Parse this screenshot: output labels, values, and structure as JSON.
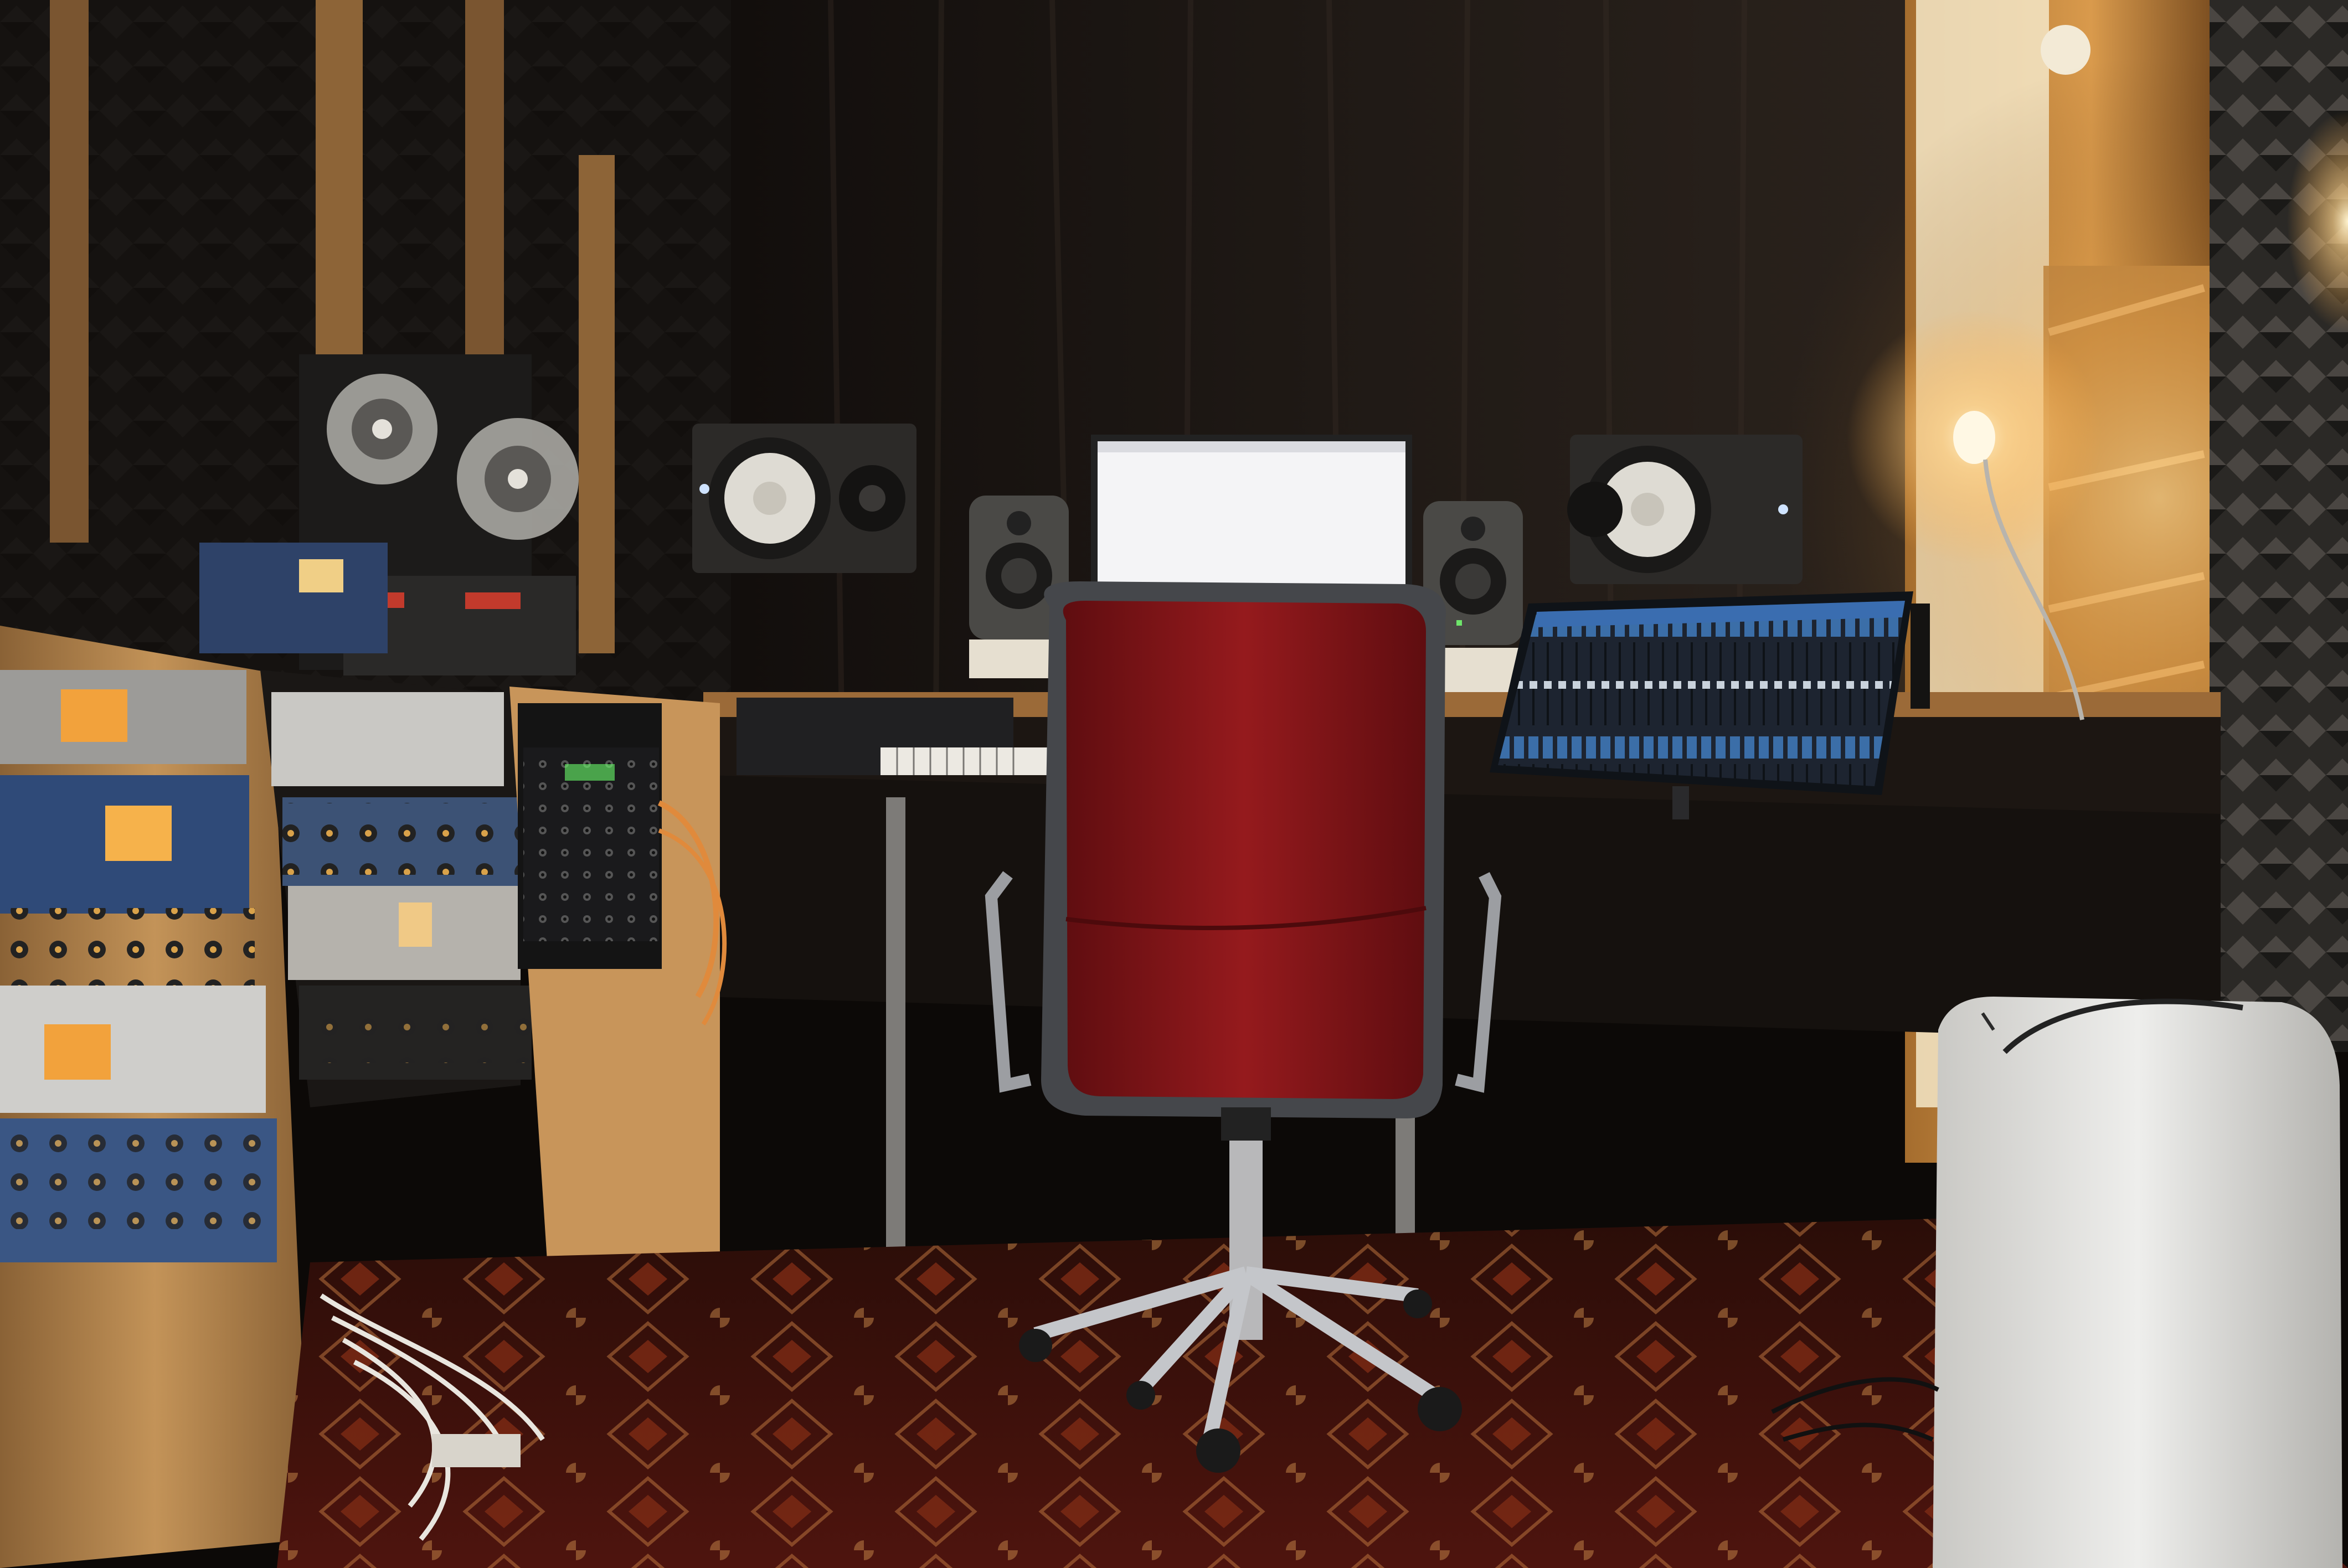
{
  "scene": {
    "type": "photograph",
    "subject": "home-recording-studio",
    "lighting": "warm-dim",
    "colors": {
      "wall_dark": "#14100d",
      "curtain": "#1c1714",
      "wood": "#b8864f",
      "rack_metal": "#9a9aa0",
      "rack_blue": "#2f4a78",
      "vu_glow": "#f2a23c",
      "lamp_glow": "#ffd38a",
      "chair_red": "#8a1418",
      "chair_frame": "#45474b",
      "monitor_white": "#f4f4f6",
      "daw_blue": "#2b5c92",
      "rug_red": "#5a1410",
      "rug_pattern": "#b8703c",
      "dehumidifier": "#e6e6e4",
      "foam_grey": "#3a3835"
    },
    "objects": [
      "acoustic-foam-wall-left",
      "wood-studs",
      "reel-to-reel-tape-recorder",
      "outboard-rack-left",
      "outboard-rack-center",
      "patchbay-rack",
      "black-curtain",
      "studio-monitor-left-large",
      "studio-monitor-left-small",
      "laptop-screen",
      "studio-monitor-right-small",
      "studio-monitor-right-large",
      "daw-mixer-display",
      "midi-keyboard",
      "desk",
      "office-chair-red",
      "desk-lamp",
      "window-with-wood-frame",
      "acoustic-foam-wall-right",
      "dehumidifier",
      "persian-rug",
      "cable-bundle"
    ]
  }
}
